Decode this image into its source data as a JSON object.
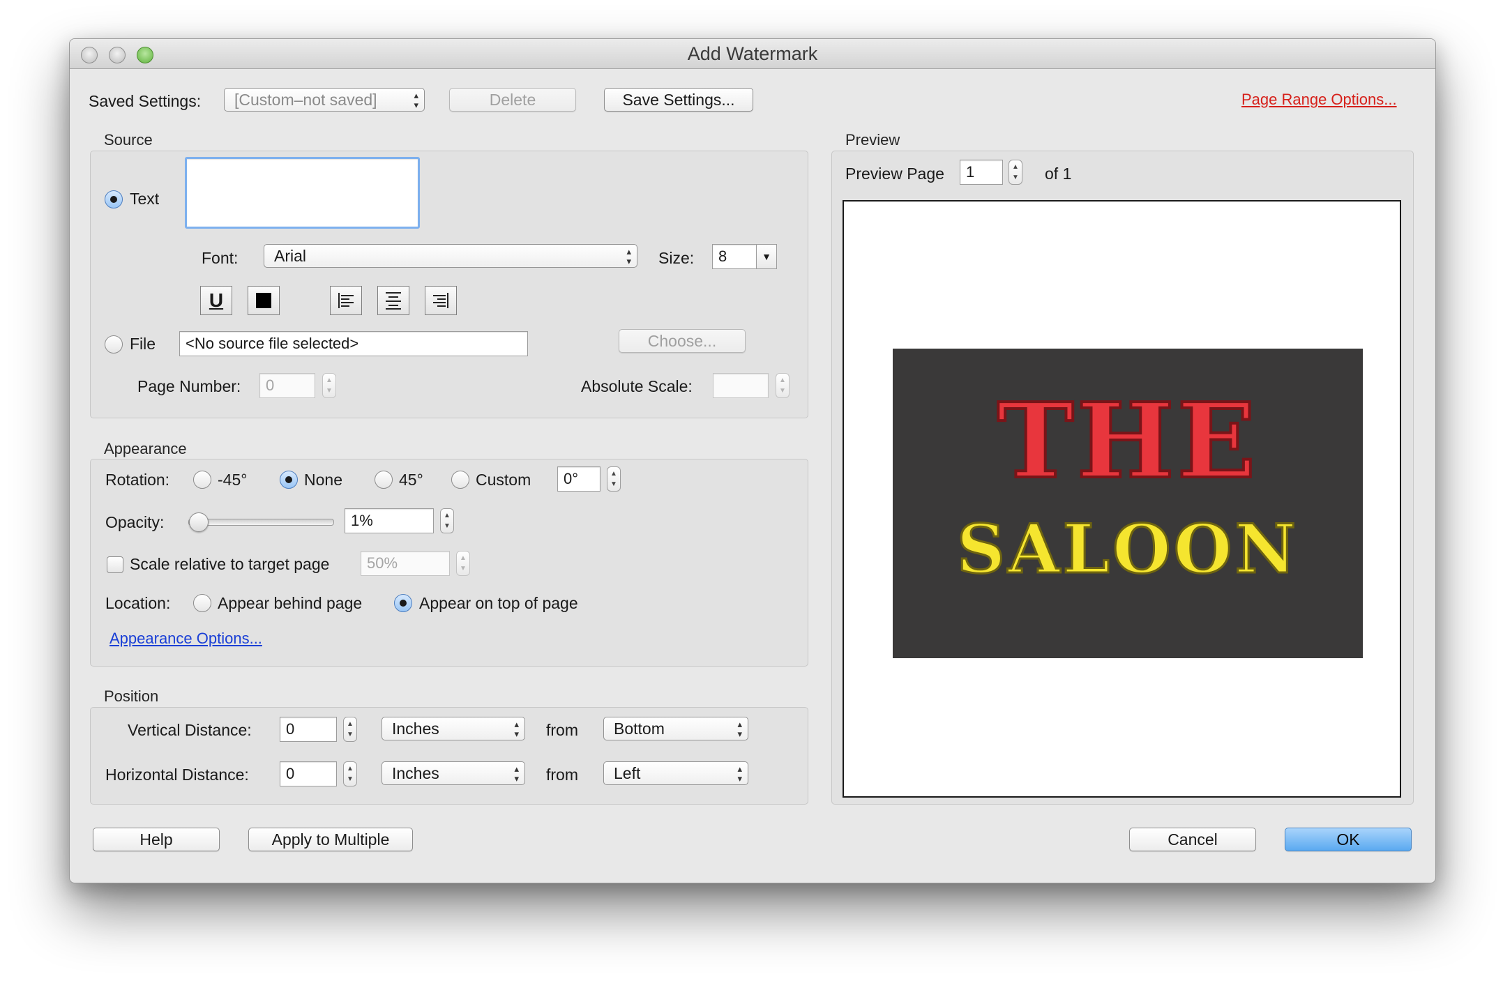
{
  "window": {
    "title": "Add Watermark"
  },
  "saved_settings": {
    "label": "Saved Settings:",
    "value": "[Custom–not saved]",
    "delete_label": "Delete",
    "save_label": "Save Settings..."
  },
  "page_range_link": "Page Range Options...",
  "source": {
    "title": "Source",
    "text_option": "Text",
    "text_value": "",
    "font_label": "Font:",
    "font_value": "Arial",
    "size_label": "Size:",
    "size_value": "8",
    "underline_glyph": "U",
    "file_option": "File",
    "file_value": "<No source file selected>",
    "choose_label": "Choose...",
    "page_number_label": "Page Number:",
    "page_number_value": "0",
    "absolute_scale_label": "Absolute Scale:",
    "absolute_scale_value": ""
  },
  "appearance": {
    "title": "Appearance",
    "rotation_label": "Rotation:",
    "rotation_options": [
      "-45°",
      "None",
      "45°",
      "Custom"
    ],
    "rotation_selected": "None",
    "custom_value": "0°",
    "opacity_label": "Opacity:",
    "opacity_value": "1%",
    "opacity_level": 0.01,
    "scale_label": "Scale relative to target page",
    "scale_checked": false,
    "scale_value": "50%",
    "location_label": "Location:",
    "location_options": [
      "Appear behind page",
      "Appear on top of page"
    ],
    "location_selected": "Appear on top of page",
    "options_link": "Appearance Options..."
  },
  "position": {
    "title": "Position",
    "vertical_label": "Vertical Distance:",
    "vertical_value": "0",
    "vertical_unit": "Inches",
    "vertical_from": "Bottom",
    "horizontal_label": "Horizontal Distance:",
    "horizontal_value": "0",
    "horizontal_unit": "Inches",
    "horizontal_from": "Left",
    "from_label": "from"
  },
  "preview": {
    "title": "Preview",
    "page_label": "Preview Page",
    "page_value": "1",
    "of_label": "of 1",
    "image_line1": "THE",
    "image_line2": "SALOON",
    "image_bg": "#3a3939",
    "line1_color": "#e8363d",
    "line2_color": "#f5e52f"
  },
  "buttons": {
    "help": "Help",
    "apply_multiple": "Apply to Multiple",
    "cancel": "Cancel",
    "ok": "OK"
  },
  "icons": {
    "underline": "underline-icon",
    "color": "color-swatch-icon",
    "align_left": "align-left-icon",
    "align_center": "align-center-icon",
    "align_right": "align-right-icon"
  }
}
